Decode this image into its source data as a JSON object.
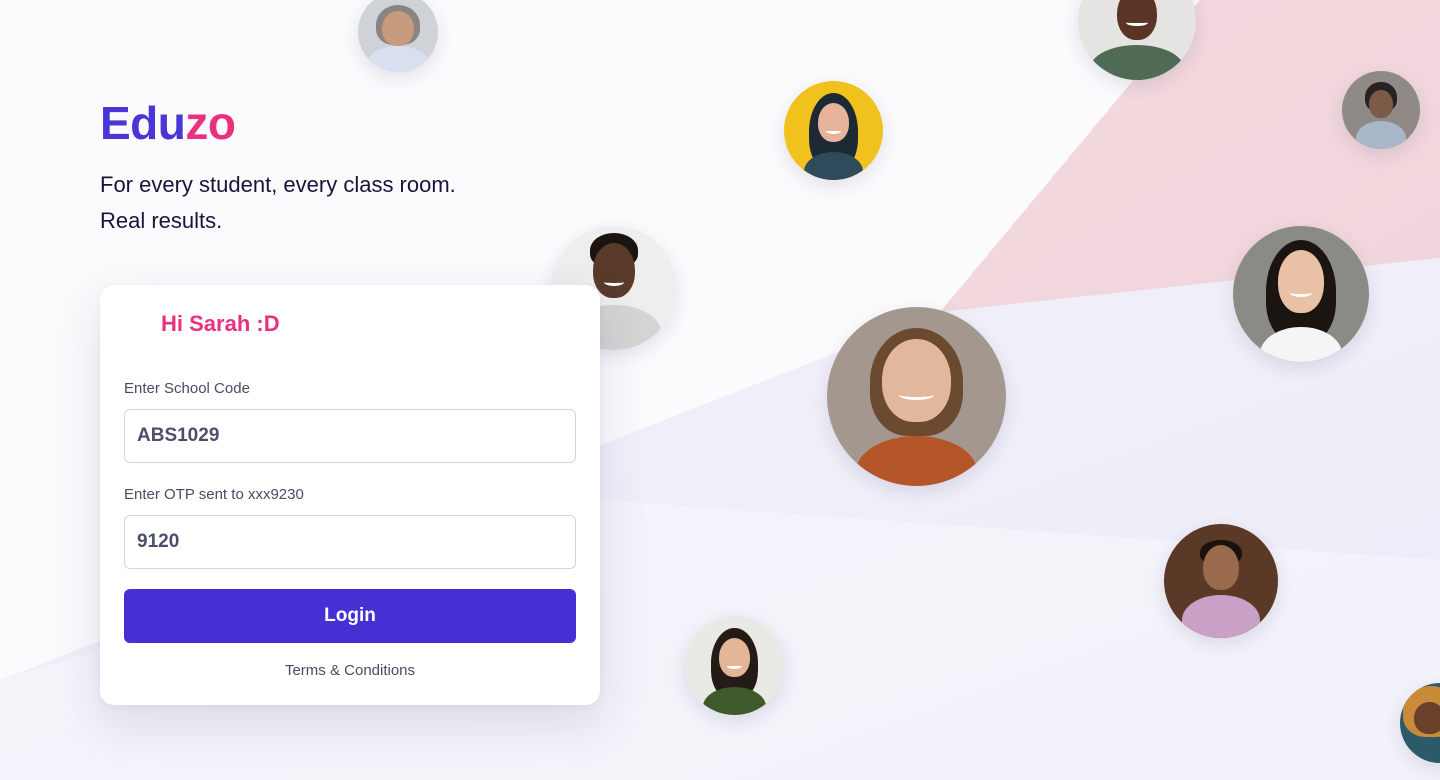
{
  "brand": {
    "part1": "Edu",
    "part2": "zo"
  },
  "tagline": {
    "line1": "For every student, every class room.",
    "line2": "Real results."
  },
  "login_card": {
    "greeting": "Hi Sarah :D",
    "school_code": {
      "label": "Enter School Code",
      "value": "ABS1029"
    },
    "otp": {
      "label": "Enter OTP sent to xxx9230",
      "value": "9120"
    },
    "login_label": "Login",
    "terms_label": "Terms & Conditions"
  },
  "colors": {
    "brand_indigo": "#4a36d4",
    "brand_pink": "#e8327f",
    "button": "#4531d3",
    "bg_pink_band": "#f2d7dc",
    "bg_lavender_band": "#ecebf8"
  },
  "avatars": [
    "user-photo",
    "user-photo",
    "user-photo",
    "user-photo",
    "user-photo",
    "user-photo",
    "user-photo",
    "user-photo",
    "user-photo",
    "user-photo",
    "user-photo"
  ]
}
